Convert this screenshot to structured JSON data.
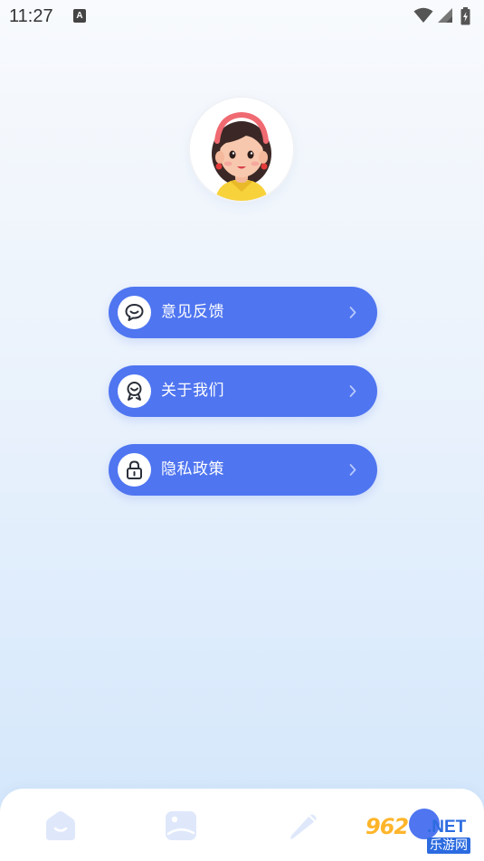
{
  "status_bar": {
    "time": "11:27",
    "notification_icon": "A",
    "icons": [
      "wifi-icon",
      "cellular-signal-icon",
      "battery-icon"
    ]
  },
  "profile": {
    "avatar": "avatar-girl-illustration"
  },
  "menu": {
    "items": [
      {
        "label": "意见反馈",
        "icon": "feedback-chat-icon"
      },
      {
        "label": "关于我们",
        "icon": "about-badge-icon"
      },
      {
        "label": "隐私政策",
        "icon": "lock-icon"
      }
    ]
  },
  "bottom_nav": {
    "items": [
      {
        "icon": "home-icon"
      },
      {
        "icon": "image-icon"
      },
      {
        "icon": "pen-icon"
      },
      {
        "icon": "profile-icon",
        "active": true
      }
    ]
  },
  "watermark": {
    "digits": "962",
    "suffix": ".NET",
    "caption": "乐游网"
  },
  "colors": {
    "accent": "#4f75f0",
    "nav_icon": "#dfe8fb",
    "background_top": "#f8fafd",
    "background_bottom": "#d2e6fb"
  }
}
